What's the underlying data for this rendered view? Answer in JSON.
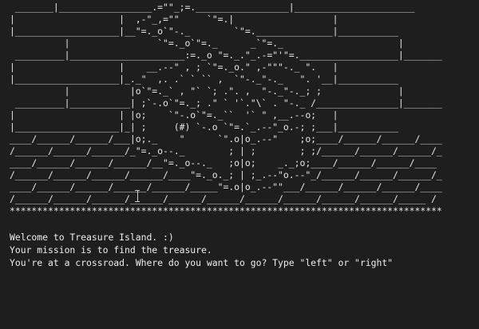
{
  "art": {
    "lines": [
      " _______|_________________.=\"\"_;=._________________|______________________",
      "|                   |  ,-\"_,=\"\"     `\"=.|                  |",
      "|___________________|__\"=._o`\"-._        `\"=.______________|___________",
      "          |                `\"=._o`\"=._      _`\"=._                     |",
      " _________|_____________________:=._o \"=._.\"_.-=\"'\"=.__________________|_______",
      "|                   |    __.--\" , ; `\"=._o.\" ,-\"\"\"-._ \".   |",
      "|___________________|_._\"  ,. .` ` `` ,  `\"-._\"-._   \". '__|___________",
      "          |           |o`\"=._` , \"` `; .\". ,  \"-._\"-._; ;              |",
      " _________|___________| ;`-.o`\"=._; .\" ` '`.\"\\` . \"-._ /_______________|_______",
      "|                   | |o;    `\"-.o`\"=._``  '` \" ,__.--o;   |",
      "|___________________|_| ;     (#) `-.o `\"=.`_.--\"_o.-; ;___|___________",
      "____/______/______/___|o;._    \"      `\".o|o_.--\"    ;o;____/______/______/____",
      "/______/______/______/_\"=._o--._        ; | ;        ; ;/______/______/______/_",
      "____/______/______/______/__\"=._o--._   ;o|o;    _._;o;____/______/______/____",
      "/______/______/______/______/____\"=._o._; | ;_.--\"o.--\"_/______/______/______/_",
      "____/______/______/______/______/_____\"=.o|o_.--\"\"___/______/______/______/____",
      "/______/______/______/______/______/______/______/______/______/______/_____ /",
      "*******************************************************************************"
    ]
  },
  "messages": [
    "Welcome to Treasure Island. :)",
    "Your mission is to find the treasure.",
    "You're at a crossroad. Where do you want to go? Type \"left\" or \"right\""
  ],
  "colors": {
    "background": "#1e1e1e",
    "text": "#e8e8e8",
    "brick_accent": "#ffd36e"
  }
}
